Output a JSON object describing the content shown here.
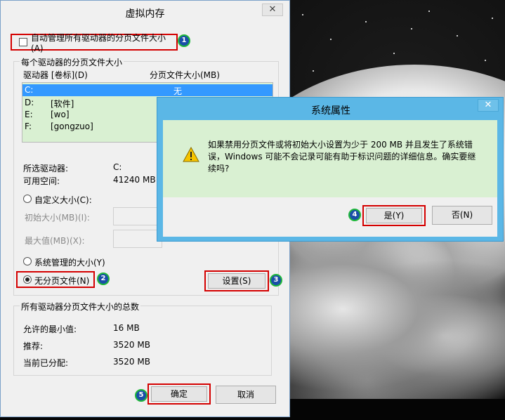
{
  "virtual_memory": {
    "title": "虚拟内存",
    "close_glyph": "✕",
    "auto_manage_label": "自动管理所有驱动器的分页文件大小(A)",
    "per_drive_legend": "每个驱动器的分页文件大小",
    "col_drive": "驱动器 [卷标](D)",
    "col_size": "分页文件大小(MB)",
    "drives": [
      {
        "drive": "C:",
        "label": "",
        "size": "无",
        "selected": true
      },
      {
        "drive": "D:",
        "label": "[软件]",
        "size": "",
        "selected": false
      },
      {
        "drive": "E:",
        "label": "[wo]",
        "size": "",
        "selected": false
      },
      {
        "drive": "F:",
        "label": "[gongzuo]",
        "size": "",
        "selected": false
      }
    ],
    "selected_drive_label": "所选驱动器:",
    "selected_drive_value": "C:",
    "free_space_label": "可用空间:",
    "free_space_value": "41240 MB",
    "custom_size_label": "自定义大小(C):",
    "initial_size_label": "初始大小(MB)(I):",
    "max_size_label": "最大值(MB)(X):",
    "system_managed_label": "系统管理的大小(Y)",
    "no_paging_label": "无分页文件(N)",
    "set_button": "设置(S)",
    "total_legend": "所有驱动器分页文件大小的总数",
    "min_allowed_label": "允许的最小值:",
    "min_allowed_value": "16 MB",
    "recommended_label": "推荐:",
    "recommended_value": "3520 MB",
    "current_alloc_label": "当前已分配:",
    "current_alloc_value": "3520 MB",
    "ok_button": "确定",
    "cancel_button": "取消",
    "radio_selected": "no_paging"
  },
  "system_properties": {
    "title": "系统属性",
    "close_glyph": "✕",
    "message": "如果禁用分页文件或将初始大小设置为少于 200 MB 并且发生了系统错误，Windows 可能不会记录可能有助于标识问题的详细信息。确实要继续吗?",
    "yes_button": "是(Y)",
    "no_button": "否(N)",
    "warning_icon": "warning-triangle-icon"
  },
  "step_badges": [
    "1",
    "2",
    "3",
    "4",
    "5"
  ],
  "colors": {
    "highlight_border": "#d40000",
    "badge_fill": "#1a4fa8",
    "badge_ring": "#1fb83a",
    "list_bg": "#d9f0d2",
    "selection": "#3399ff",
    "dialog2_frame": "#5bb7e6"
  }
}
